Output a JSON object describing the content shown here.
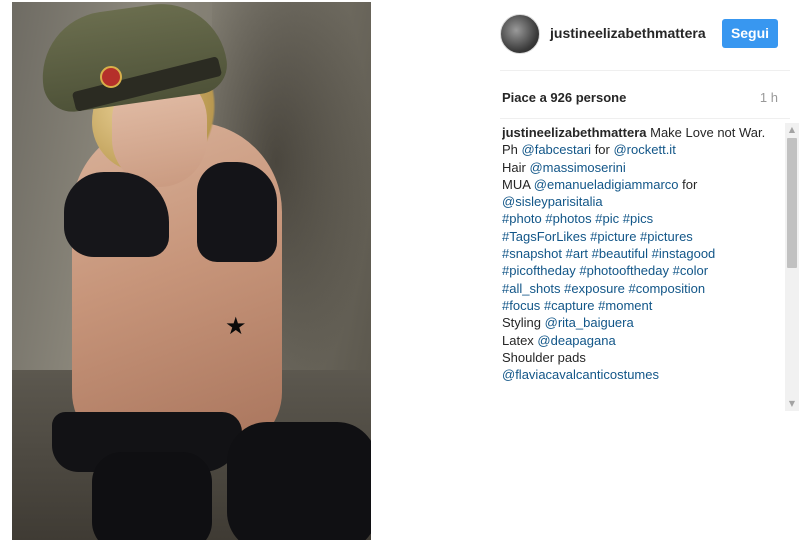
{
  "post": {
    "username": "justineelizabethmattera",
    "follow_label": "Segui",
    "likes_text": "Piace a 926 persone",
    "time_ago": "1 h",
    "censor_star": "★"
  },
  "caption": {
    "author": "justineelizabethmattera",
    "line1": " Make Love not War.",
    "ph_prefix": "Ph ",
    "ph_handle": "@fabcestari",
    "ph_mid": " for ",
    "ph_client": "@rockett.it",
    "hair_prefix": "Hair ",
    "hair_handle": "@massimoserini",
    "mua_prefix": "MUA ",
    "mua_handle": "@emanueladigiammarco",
    "mua_mid": " for ",
    "mua_client": "@sisleyparisitalia",
    "hashtags": [
      "#photo",
      "#photos",
      "#pic",
      "#pics",
      "#TagsForLikes",
      "#picture",
      "#pictures",
      "#snapshot",
      "#art",
      "#beautiful",
      "#instagood",
      "#picoftheday",
      "#photooftheday",
      "#color",
      "#all_shots",
      "#exposure",
      "#composition",
      "#focus",
      "#capture",
      "#moment"
    ],
    "styling_prefix": "Styling ",
    "styling_handle": "@rita_baiguera",
    "latex_prefix": "Latex ",
    "latex_handle": "@deapagana",
    "pads_prefix": "Shoulder pads",
    "pads_handle": "@flaviacavalcanticostumes"
  },
  "colors": {
    "follow_button": "#3897f0",
    "link": "#125688",
    "text": "#262626",
    "muted": "#999999"
  },
  "icons": {
    "scroll_up": "▲",
    "scroll_down": "▼"
  }
}
